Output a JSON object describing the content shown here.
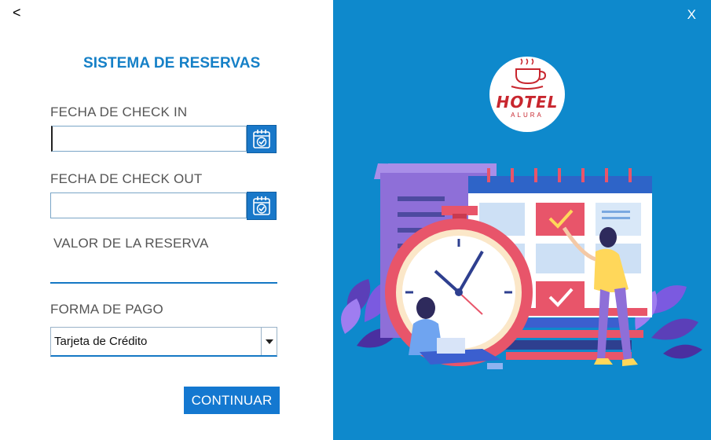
{
  "nav": {
    "back": "<",
    "close": "X"
  },
  "form": {
    "title": "SISTEMA DE RESERVAS",
    "checkin_label": "FECHA DE CHECK IN",
    "checkin_value": "",
    "checkout_label": "FECHA DE CHECK OUT",
    "checkout_value": "",
    "value_label": "VALOR DE LA RESERVA",
    "value_value": "",
    "payment_label": "FORMA DE PAGO",
    "payment_selected": "Tarjeta de Crédito",
    "continue_label": "CONTINUAR"
  },
  "logo": {
    "name": "HOTEL",
    "sub": "ALURA"
  },
  "icons": {
    "calendar_checkin": "calendar-check-icon",
    "calendar_checkout": "calendar-check-icon",
    "dropdown": "triangle-down-icon",
    "logo_cup": "coffee-cup-icon"
  },
  "colors": {
    "brand_blue": "#1580c7",
    "panel_blue": "#0e89cc",
    "button_blue": "#1478d0",
    "logo_red": "#c8262e"
  }
}
